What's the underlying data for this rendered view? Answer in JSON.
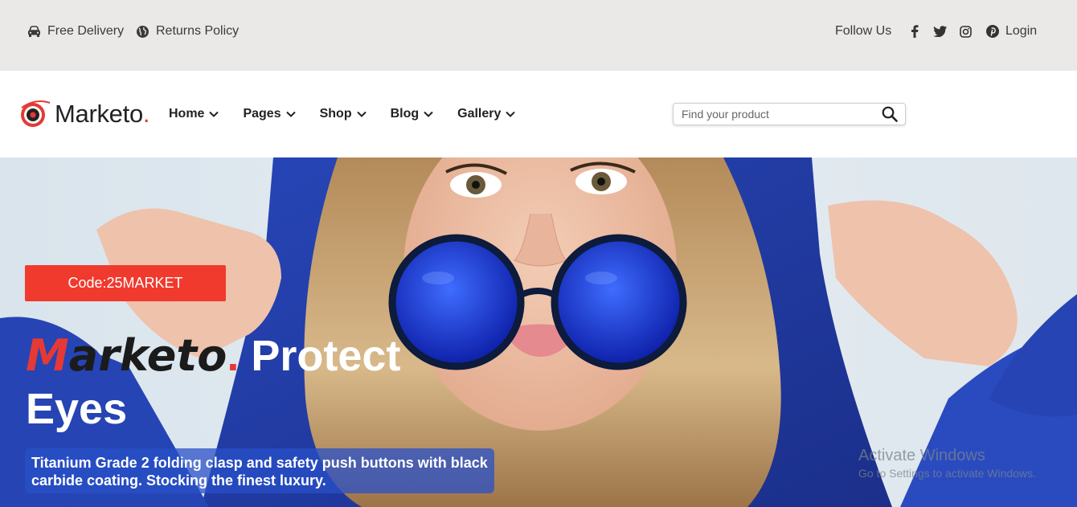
{
  "topbar": {
    "free_delivery": "Free Delivery",
    "returns_policy": "Returns Policy",
    "follow_us": "Follow Us",
    "login": "Login",
    "icons": [
      "car-icon",
      "globe-icon",
      "facebook-icon",
      "twitter-icon",
      "instagram-icon",
      "pinterest-icon"
    ]
  },
  "header": {
    "logo_text": "Marketo",
    "logo_dot": ".",
    "nav": [
      "Home",
      "Pages",
      "Shop",
      "Blog",
      "Gallery"
    ],
    "search_placeholder": "Find your product"
  },
  "hero": {
    "code": "Code:25MARKET",
    "title_brand_m": "M",
    "title_brand_rest": "arketo",
    "title_brand_dot": ".",
    "title_line1": "Protect",
    "title_line2": "Eyes",
    "description": "Titanium Grade 2 folding clasp and safety push buttons with black carbide coating. Stocking the finest luxury."
  },
  "watermark": {
    "title": "Activate Windows",
    "subtitle": "Go to Settings to activate Windows."
  },
  "colors": {
    "accent_red": "#f03a2e",
    "topbar_bg": "#ebe9e7",
    "desc_bg": "#2850c8"
  }
}
